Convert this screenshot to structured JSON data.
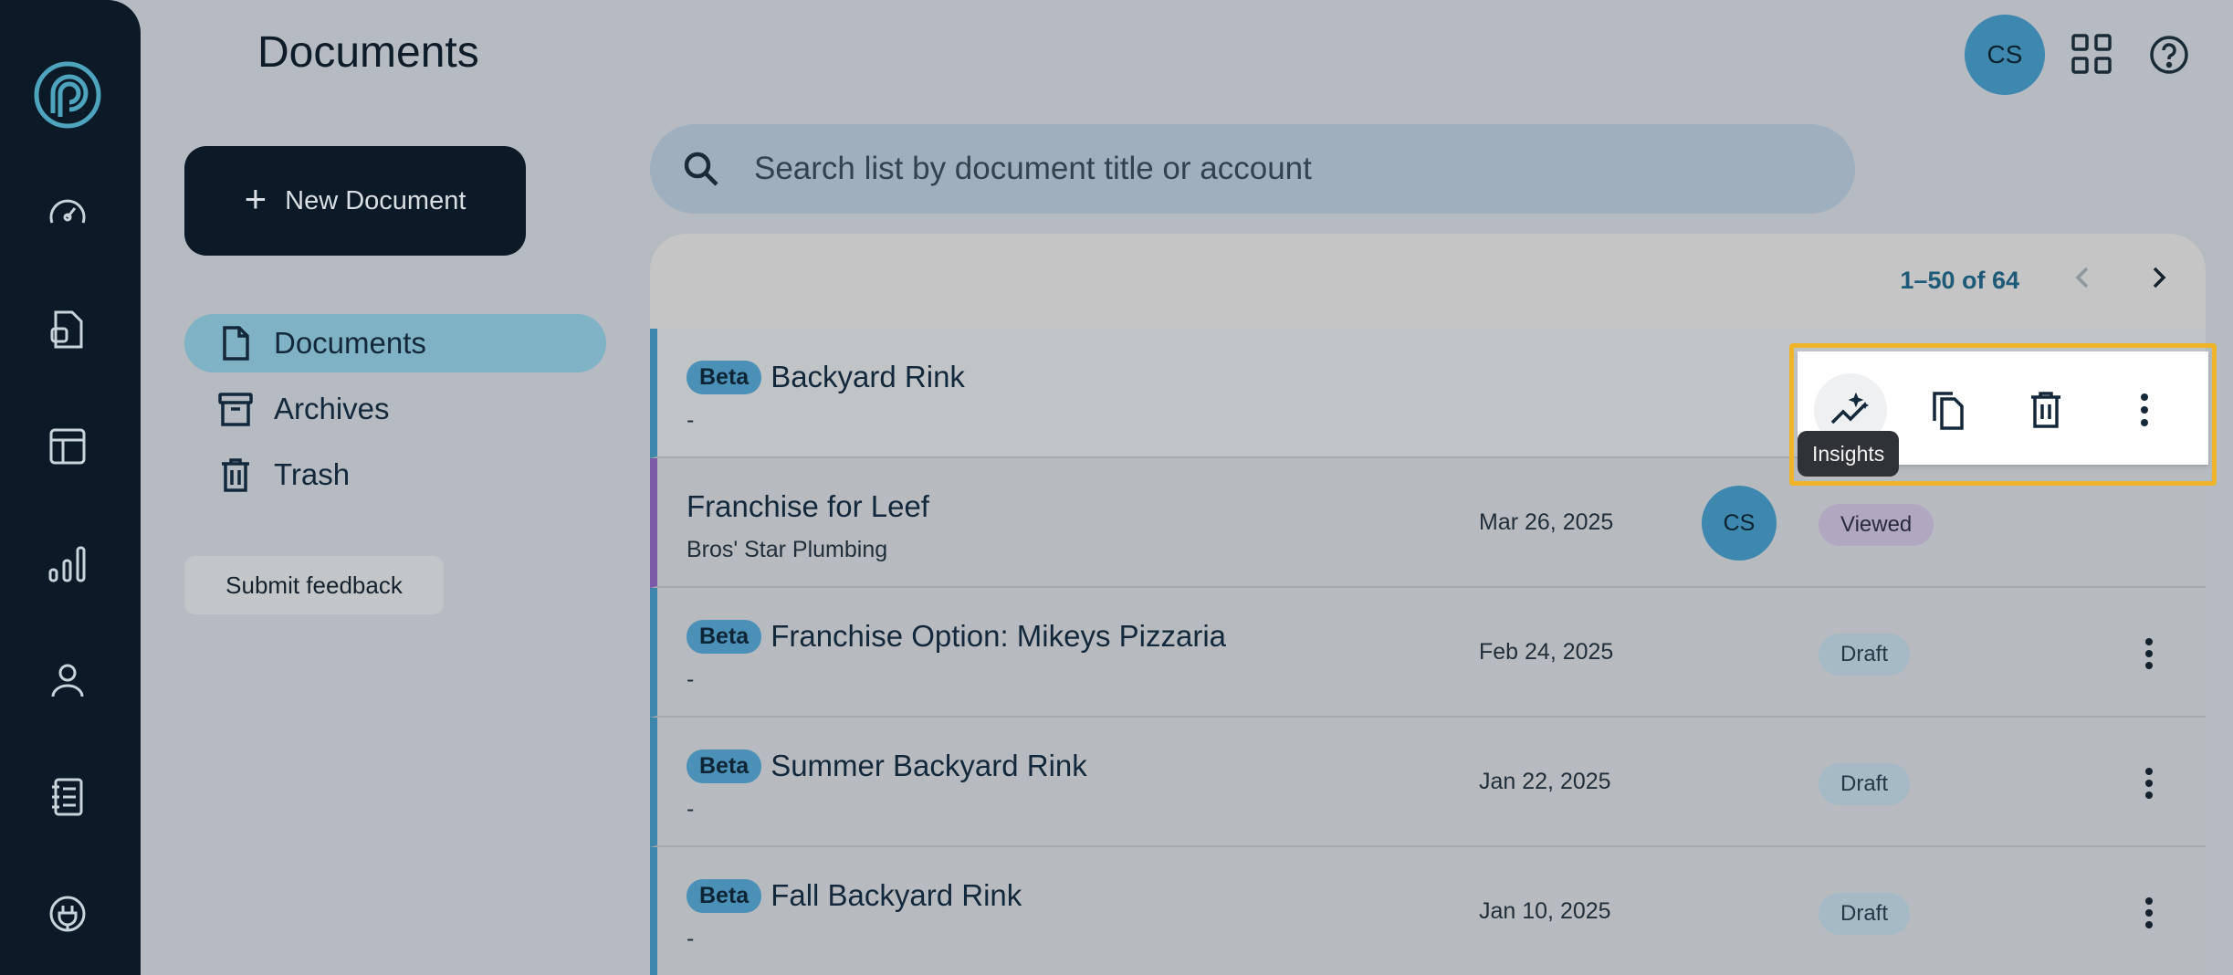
{
  "app": {
    "page_title": "Documents"
  },
  "header": {
    "user_initials": "CS"
  },
  "sidebar_nav": [
    "dashboard-icon",
    "documents-icon",
    "table-icon",
    "analytics-icon",
    "user-icon",
    "catalog-icon",
    "integrations-icon"
  ],
  "left_panel": {
    "new_document_label": "New Document",
    "items": [
      {
        "label": "Documents",
        "icon": "document-icon",
        "active": true
      },
      {
        "label": "Archives",
        "icon": "archive-icon",
        "active": false
      },
      {
        "label": "Trash",
        "icon": "trash-icon",
        "active": false
      }
    ],
    "feedback_label": "Submit feedback"
  },
  "search": {
    "placeholder": "Search list by document title or account",
    "value": ""
  },
  "pagination": {
    "range": "1–50 of 64"
  },
  "documents": [
    {
      "beta": "Beta",
      "title": "Backyard Rink",
      "subtitle": "-",
      "date": "",
      "owner": "",
      "status": ""
    },
    {
      "beta": "",
      "title": "Franchise for Leef",
      "subtitle": "Bros' Star Plumbing",
      "date": "Mar 26, 2025",
      "owner": "CS",
      "status": "Viewed"
    },
    {
      "beta": "Beta",
      "title": "Franchise Option: Mikeys Pizzaria",
      "subtitle": "-",
      "date": "Feb 24, 2025",
      "owner": "",
      "status": "Draft"
    },
    {
      "beta": "Beta",
      "title": "Summer Backyard Rink",
      "subtitle": "-",
      "date": "Jan 22, 2025",
      "owner": "",
      "status": "Draft"
    },
    {
      "beta": "Beta",
      "title": "Fall Backyard Rink",
      "subtitle": "-",
      "date": "Jan 10, 2025",
      "owner": "",
      "status": "Draft"
    }
  ],
  "row_actions": {
    "buttons": [
      "insights-icon",
      "copy-icon",
      "delete-icon",
      "more-vert-icon"
    ],
    "tooltip": "Insights"
  },
  "colors": {
    "rail": "#0b1a26",
    "accent": "#3e87ae",
    "highlight": "#f0b429"
  }
}
